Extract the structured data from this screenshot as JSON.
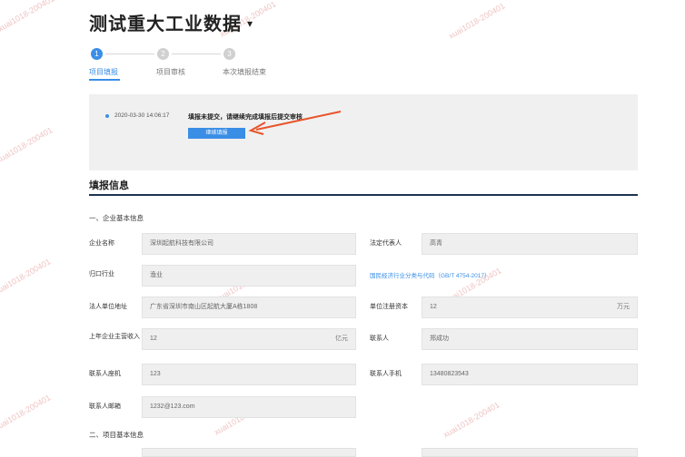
{
  "page": {
    "title": "测试重大工业数据",
    "title_caret": "▾"
  },
  "steps": [
    {
      "num": "1",
      "label": "项目填报"
    },
    {
      "num": "2",
      "label": "项目审核"
    },
    {
      "num": "3",
      "label": "本次填报结束"
    }
  ],
  "notice": {
    "timestamp": "2020-03-30 14:06:17",
    "message": "填报未提交，请继续完成填报后提交审核",
    "button": "继续填报"
  },
  "section": {
    "title": "填报信息",
    "sub1": "一、企业基本信息",
    "sub2": "二、项目基本信息"
  },
  "form": {
    "company_name_label": "企业名称",
    "company_name": "深圳起航科技有限公司",
    "legal_rep_label": "法定代表人",
    "legal_rep": "高青",
    "industry_label": "归口行业",
    "industry": "渔业",
    "industry_code_link": "国民经济行业分类与代码（GB/T 4754-2017）",
    "address_label": "法人单位地址",
    "address": "广东省深圳市南山区起航大厦A栋1808",
    "capital_label": "单位注册资本",
    "capital": "12",
    "capital_unit": "万元",
    "revenue_label": "上年企业主营收入",
    "revenue": "12",
    "revenue_unit": "亿元",
    "contact_label": "联系人",
    "contact": "郑成功",
    "landline_label": "联系人座机",
    "landline": "123",
    "mobile_label": "联系人手机",
    "mobile": "13480823543",
    "email_label": "联系人邮箱",
    "email": "1232@123.com"
  },
  "watermark": "xuai1018-200401",
  "colors": {
    "accent": "#3a8ee6",
    "rule": "#1d3350",
    "arrow": "#e8542b"
  }
}
